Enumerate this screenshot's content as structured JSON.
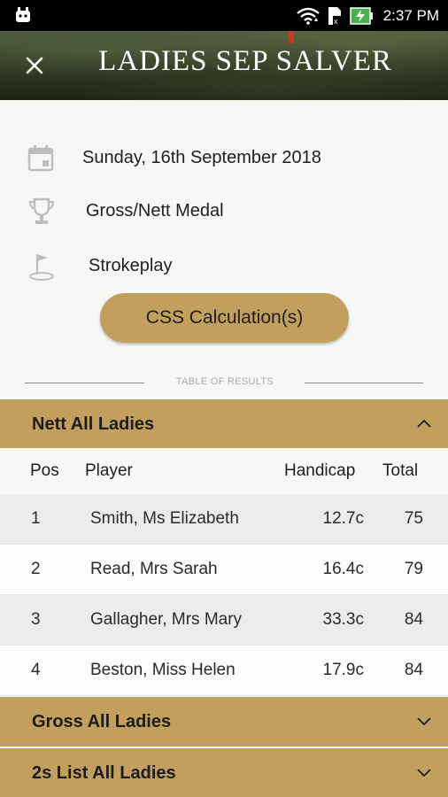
{
  "status_bar": {
    "time": "2:37 PM"
  },
  "header": {
    "title": "LADIES SEP SALVER"
  },
  "info": {
    "date": "Sunday, 16th September 2018",
    "competition": "Gross/Nett Medal",
    "format": "Strokeplay"
  },
  "css_button": "CSS Calculation(s)",
  "divider_text": "TABLE OF RESULTS",
  "sections": [
    {
      "label": "Nett All Ladies",
      "expanded": true
    },
    {
      "label": "Gross All Ladies",
      "expanded": false
    },
    {
      "label": "2s List All Ladies",
      "expanded": false
    }
  ],
  "table": {
    "columns": [
      "Pos",
      "Player",
      "Handicap",
      "Total"
    ],
    "rows": [
      {
        "pos": "1",
        "player": "Smith, Ms Elizabeth",
        "handicap": "12.7c",
        "total": "75"
      },
      {
        "pos": "2",
        "player": "Read, Mrs Sarah",
        "handicap": "16.4c",
        "total": "79"
      },
      {
        "pos": "3",
        "player": "Gallagher, Mrs Mary",
        "handicap": "33.3c",
        "total": "84"
      },
      {
        "pos": "4",
        "player": "Beston, Miss Helen",
        "handicap": "17.9c",
        "total": "84"
      }
    ]
  },
  "colors": {
    "accent": "#c39f5e",
    "status_bar": "#000000",
    "battery": "#4caf50"
  },
  "icons": [
    "android-icon",
    "wifi-icon",
    "sim-icon",
    "battery-charging-icon",
    "close-icon",
    "calendar-icon",
    "trophy-icon",
    "golf-flag-icon",
    "chevron-up-icon",
    "chevron-down-icon"
  ]
}
